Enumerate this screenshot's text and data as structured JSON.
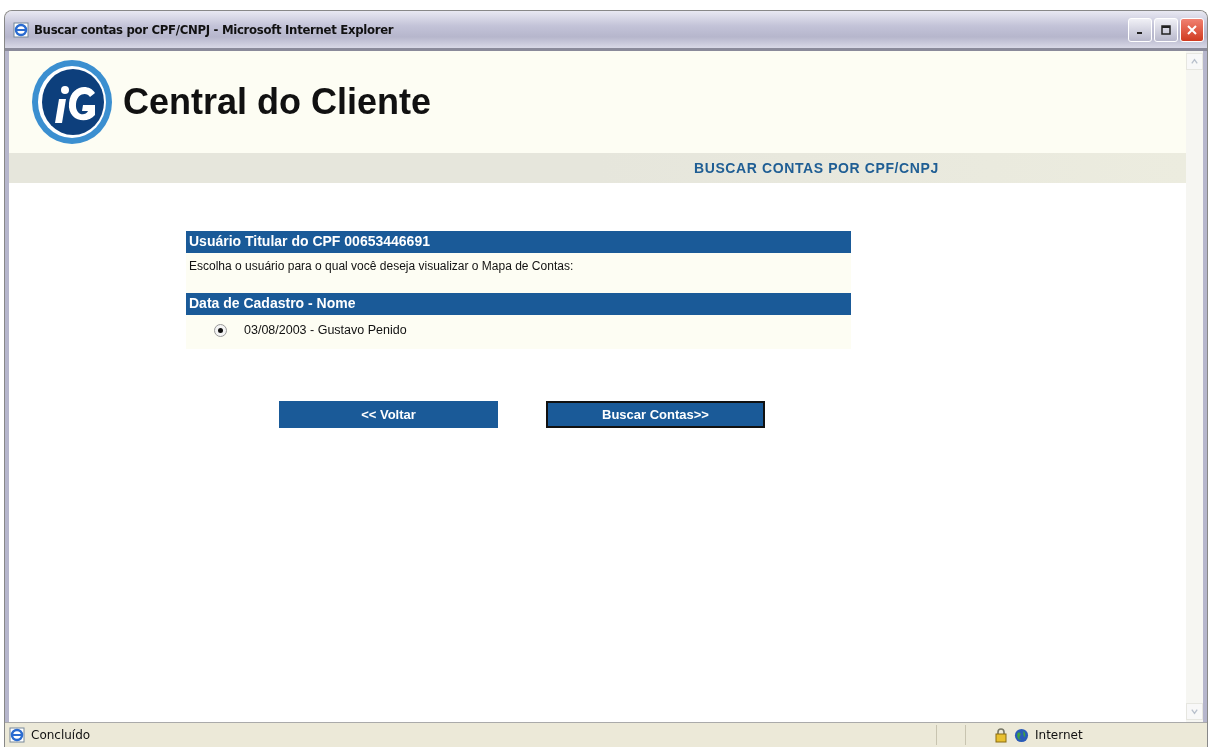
{
  "window": {
    "title": "Buscar contas por CPF/CNPJ - Microsoft Internet Explorer"
  },
  "header": {
    "title": "Central do Cliente",
    "section": "BUSCAR CONTAS POR CPF/CNPJ"
  },
  "panel": {
    "heading": "Usuário Titular do CPF 00653446691",
    "instruction": "Escolha o usuário para o qual você deseja visualizar o Mapa de Contas:",
    "list_heading": "Data de Cadastro - Nome",
    "options": [
      {
        "label": "03/08/2003 - Gustavo Penido",
        "selected": true
      }
    ]
  },
  "buttons": [
    {
      "label": "<< Voltar",
      "focused": false
    },
    {
      "label": "Buscar Contas>>",
      "focused": true
    }
  ],
  "status_bar": {
    "text": "Concluído",
    "zone": "Internet"
  }
}
